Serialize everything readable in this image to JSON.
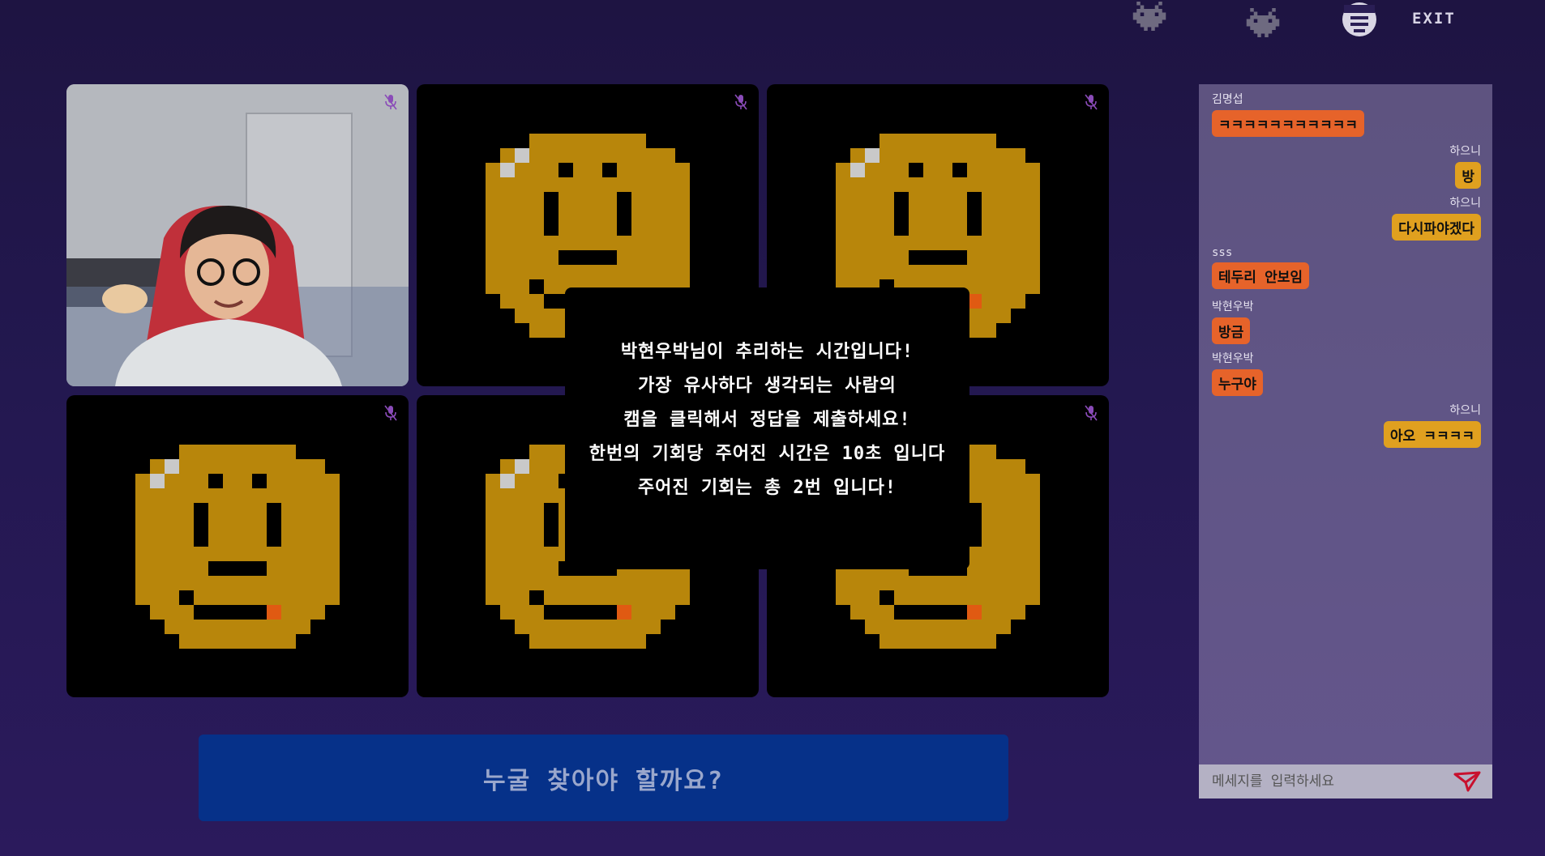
{
  "header": {
    "icons": [
      "space-invader-icon",
      "space-invader-icon",
      "chat-robot-icon"
    ],
    "exit_label": "EXIT"
  },
  "overlay": {
    "lines": [
      "박현우박님이 추리하는 시간입니다!",
      "가장 유사하다 생각되는 사람의",
      "캠을 클릭해서 정답을 제출하세요!",
      "한번의 기회당 주어진 시간은 10초 입니다",
      "주어진 기회는 총 2번 입니다!"
    ]
  },
  "question_button": "누굴 찾아야 할까요?",
  "chat": {
    "messages": [
      {
        "name": "김명섭",
        "text": "ㅋㅋㅋㅋㅋㅋㅋㅋㅋㅋㅋ",
        "align": "left",
        "color": "orange"
      },
      {
        "name": "하으니",
        "text": "방",
        "align": "right",
        "color": "gold"
      },
      {
        "name": "하으니",
        "text": "다시파야겠다",
        "align": "right",
        "color": "gold"
      },
      {
        "name": "sss",
        "text": "테두리 안보임",
        "align": "left",
        "color": "orange"
      },
      {
        "name": "박현우박",
        "text": "방금",
        "align": "left",
        "color": "orange"
      },
      {
        "name": "박현우박",
        "text": "누구야",
        "align": "left",
        "color": "orange"
      },
      {
        "name": "하으니",
        "text": "아오 ㅋㅋㅋㅋ",
        "align": "right",
        "color": "gold"
      }
    ],
    "input_placeholder": "메세지를 입력하세요"
  },
  "colors": {
    "background": "#231850",
    "face_yellow": "#b8860b",
    "question_bg": "#063189",
    "bubble_orange": "#e6632a",
    "bubble_gold": "#e0a01f"
  }
}
